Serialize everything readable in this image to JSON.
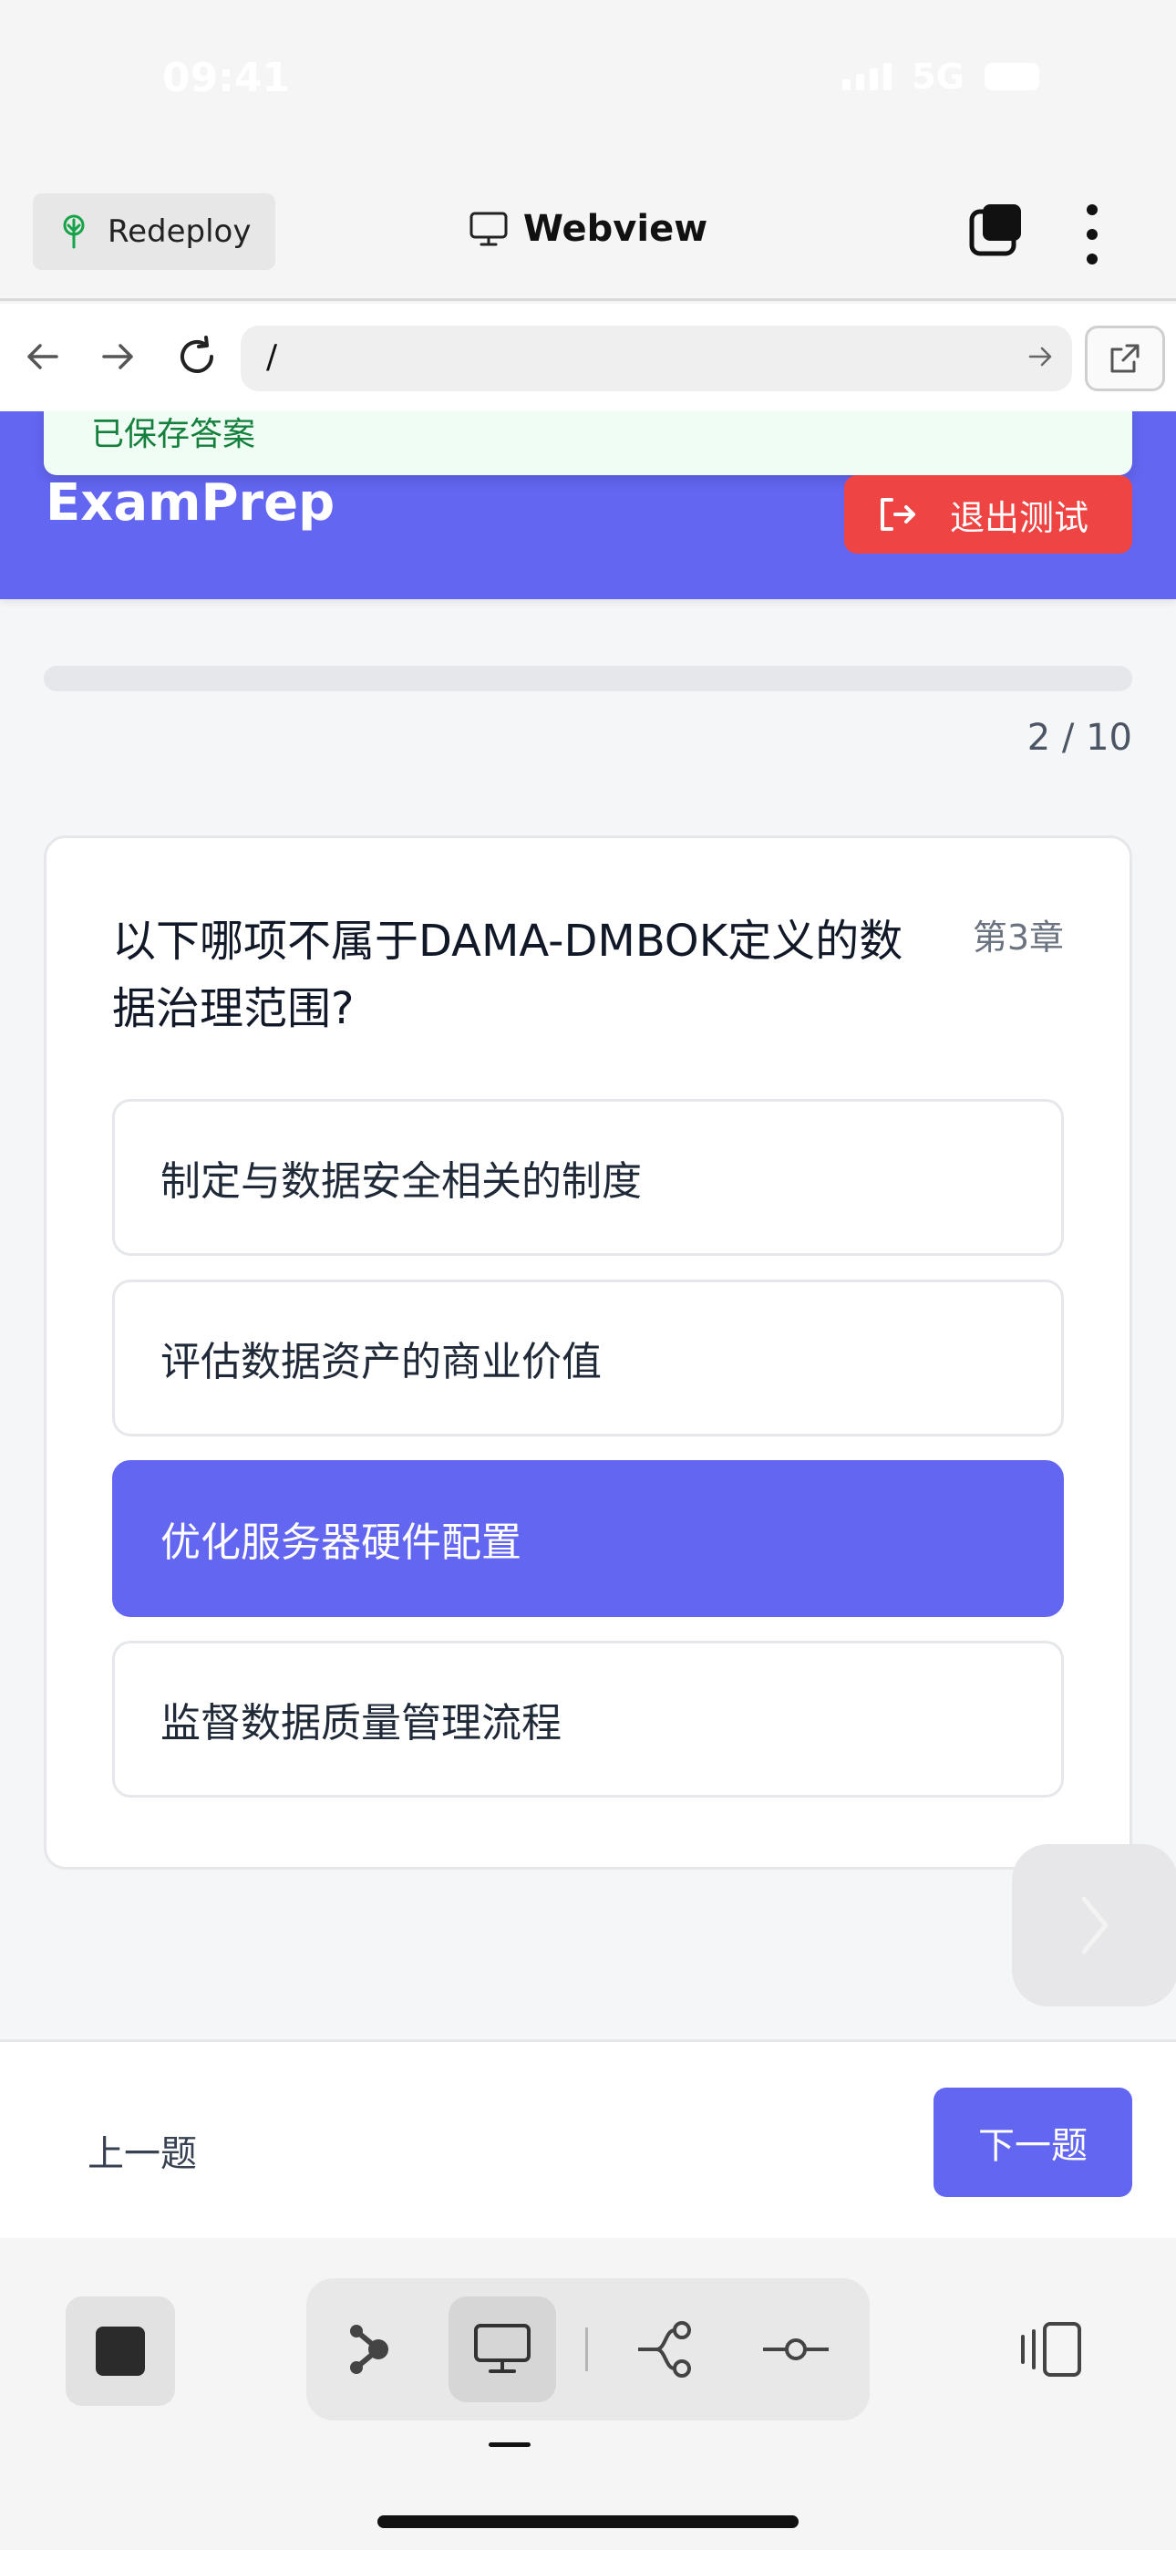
{
  "status_bar": {
    "time": "09:41",
    "network": "5G"
  },
  "topbar": {
    "redeploy_label": "Redeploy",
    "title": "Webview"
  },
  "urlbar": {
    "url": "/"
  },
  "app": {
    "toast": "已保存答案",
    "brand": "ExamPrep",
    "exit_label": "退出测试",
    "progress": {
      "current": 2,
      "total": 10,
      "label": "2 / 10"
    }
  },
  "question": {
    "text": "以下哪项不属于DAMA-DMBOK定义的数据治理范围?",
    "chapter": "第3章",
    "options": [
      {
        "label": "制定与数据安全相关的制度",
        "selected": false
      },
      {
        "label": "评估数据资产的商业价值",
        "selected": false
      },
      {
        "label": "优化服务器硬件配置",
        "selected": true
      },
      {
        "label": "监督数据质量管理流程",
        "selected": false
      }
    ]
  },
  "footer": {
    "prev_label": "上一题",
    "next_label": "下一题"
  },
  "colors": {
    "primary": "#6366f1",
    "danger": "#ef4444",
    "toast_bg": "#f0fdf4",
    "toast_text": "#15803d"
  }
}
